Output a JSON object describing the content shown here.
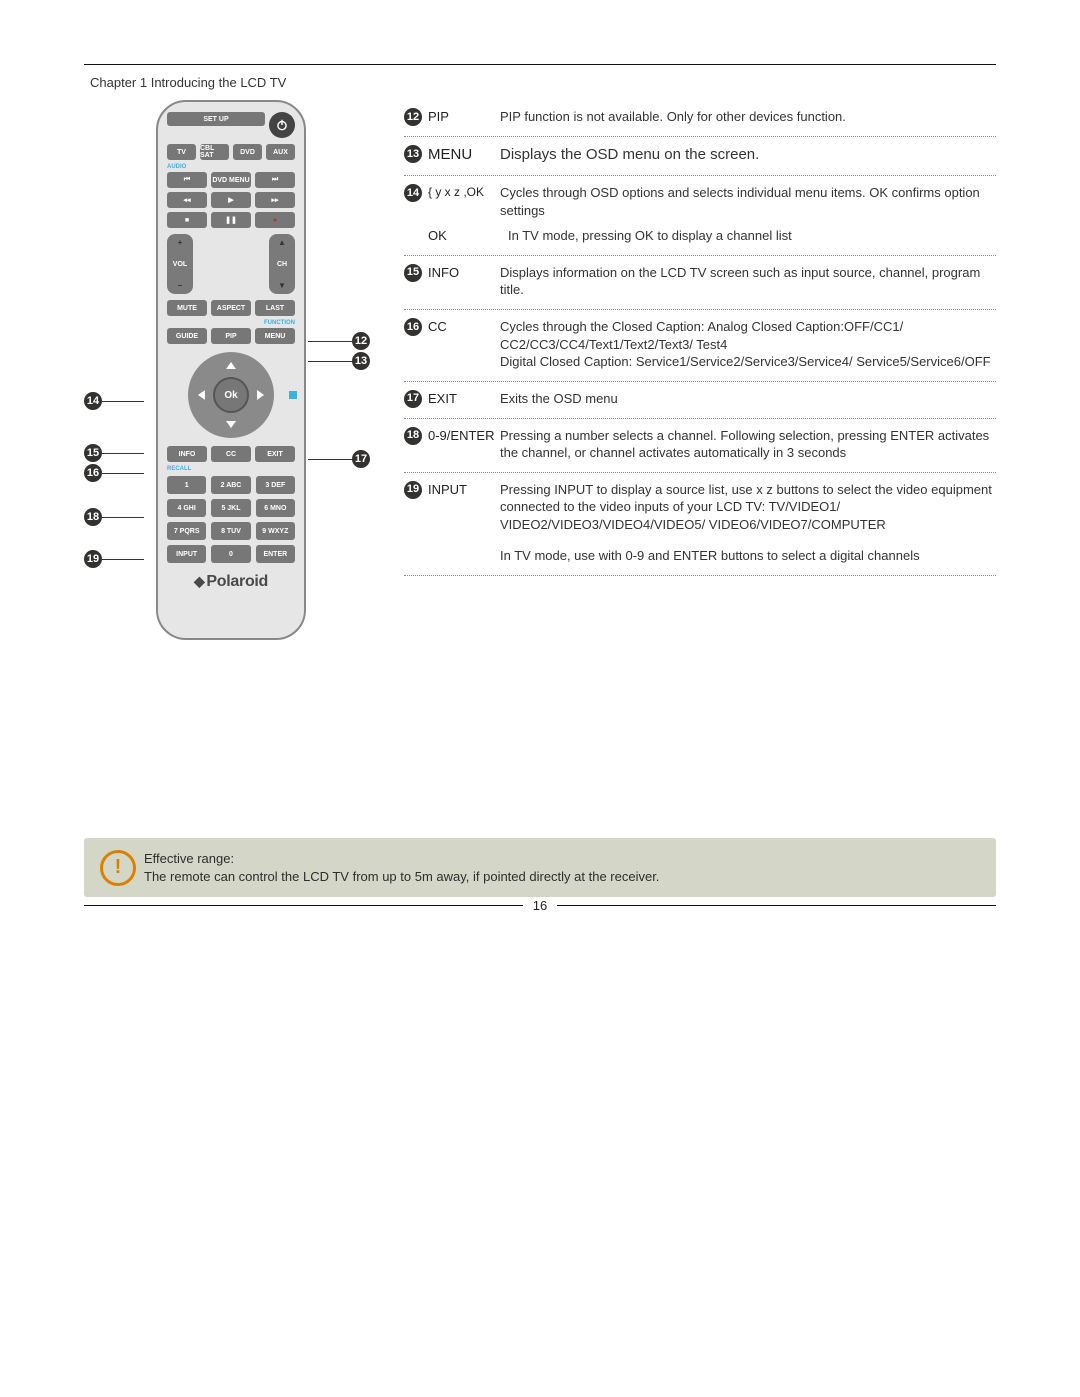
{
  "chapter_title": "Chapter 1  Introducing the LCD TV",
  "page_number": "16",
  "note": {
    "title": "Effective range:",
    "body": "The remote can control the LCD TV from up to 5m away, if pointed directly at the receiver."
  },
  "remote": {
    "setup": "SET UP",
    "row1": [
      "TV",
      "CBL SAT",
      "DVD",
      "AUX"
    ],
    "accent_audio": "AUDIO",
    "row_trans": [
      "⏮",
      "DVD MENU",
      "⏭"
    ],
    "row_play": [
      "◂◂",
      "▶",
      "▸▸"
    ],
    "row_stop": [
      "■",
      "❚❚",
      "●"
    ],
    "vol": {
      "plus": "+",
      "label": "VOL",
      "minus": "−"
    },
    "ch": {
      "up": "▲",
      "label": "CH",
      "down": "▼"
    },
    "row_mute": [
      "MUTE",
      "ASPECT",
      "LAST"
    ],
    "accent_function": "FUNCTION",
    "row_guide": [
      "GUIDE",
      "PIP",
      "MENU"
    ],
    "ok": "Ok",
    "row_info": [
      "INFO",
      "CC",
      "EXIT"
    ],
    "accent_recall": "RECALL",
    "numpad": [
      "1",
      "2 ABC",
      "3 DEF",
      "4 GHI",
      "5 JKL",
      "6 MNO",
      "7 PQRS",
      "8 TUV",
      "9 WXYZ",
      "INPUT",
      "0",
      "ENTER"
    ],
    "logo": "Polaroid"
  },
  "callouts": {
    "l14": "14",
    "l15": "15",
    "l16": "16",
    "l18": "18",
    "l19": "19",
    "r12": "12",
    "r13": "13",
    "r17": "17"
  },
  "rows": [
    {
      "n": "12",
      "label": "PIP",
      "desc": "PIP function is not available. Only for other devices function."
    },
    {
      "n": "13",
      "label": "MENU",
      "desc": "Displays the OSD menu on the screen."
    },
    {
      "n": "14",
      "label": "{   y  x z  ,OK",
      "desc": "Cycles through OSD options and selects individual menu items. OK confirms option settings",
      "sublabel": "OK",
      "subdesc": "In TV mode, pressing OK to display a channel list"
    },
    {
      "n": "15",
      "label": "INFO",
      "desc": "Displays information on the LCD TV screen such as input source, channel, program title."
    },
    {
      "n": "16",
      "label": "CC",
      "desc": "Cycles through the Closed Caption: Analog Closed Caption:OFF/CC1/ CC2/CC3/CC4/Text1/Text2/Text3/ Test4\nDigital Closed Caption: Service1/Service2/Service3/Service4/ Service5/Service6/OFF"
    },
    {
      "n": "17",
      "label": "EXIT",
      "desc": "Exits the OSD menu"
    },
    {
      "n": "18",
      "label": "0-9/ENTER",
      "desc": "Pressing a number selects a channel. Following selection, pressing ENTER activates the channel, or channel activates automatically in 3 seconds"
    },
    {
      "n": "19",
      "label": "INPUT",
      "desc": "Pressing INPUT to display a source list, use  x z  buttons to select  the video equipment connected to the video inputs of your LCD TV: TV/VIDEO1/ VIDEO2/VIDEO3/VIDEO4/VIDEO5/ VIDEO6/VIDEO7/COMPUTER",
      "extra": "In TV mode, use with 0-9 and ENTER buttons to select a digital channels"
    }
  ]
}
